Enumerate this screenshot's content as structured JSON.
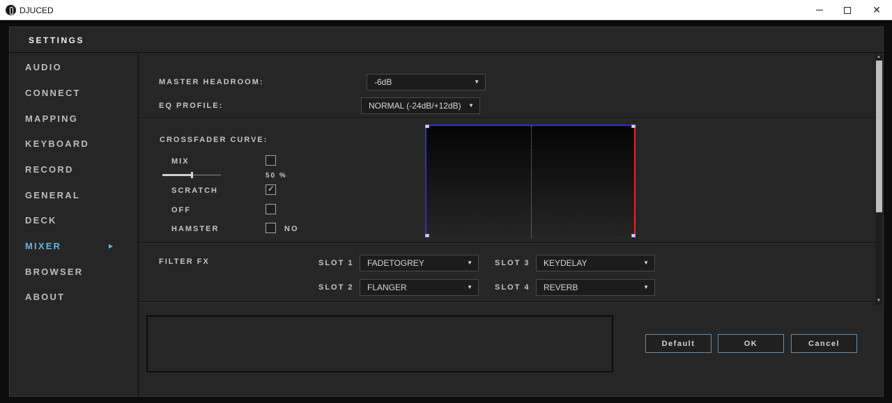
{
  "window": {
    "title": "DJUCED"
  },
  "settings": {
    "title": "SETTINGS"
  },
  "sidebar": {
    "items": [
      {
        "label": "AUDIO"
      },
      {
        "label": "CONNECT"
      },
      {
        "label": "MAPPING"
      },
      {
        "label": "KEYBOARD"
      },
      {
        "label": "RECORD"
      },
      {
        "label": "GENERAL"
      },
      {
        "label": "DECK"
      },
      {
        "label": "MIXER",
        "active": true
      },
      {
        "label": "BROWSER"
      },
      {
        "label": "ABOUT"
      }
    ]
  },
  "mixer": {
    "master_headroom": {
      "label": "MASTER HEADROOM:",
      "value": "-6dB"
    },
    "eq_profile": {
      "label": "EQ PROFILE:",
      "value": "NORMAL (-24dB/+12dB)"
    },
    "crossfader": {
      "label": "CROSSFADER CURVE:",
      "mix": {
        "label": "MIX",
        "checked": false
      },
      "slider": {
        "percent": 50,
        "value_text": "50",
        "unit": "%"
      },
      "scratch": {
        "label": "SCRATCH",
        "checked": true
      },
      "off": {
        "label": "OFF",
        "checked": false
      },
      "hamster": {
        "label": "HAMSTER",
        "checked": false,
        "state_text": "NO"
      }
    },
    "filter_fx": {
      "label": "FILTER FX",
      "slots": [
        {
          "label": "SLOT 1",
          "value": "FADETOGREY"
        },
        {
          "label": "SLOT 2",
          "value": "FLANGER"
        },
        {
          "label": "SLOT 3",
          "value": "KEYDELAY"
        },
        {
          "label": "SLOT 4",
          "value": "REVERB"
        }
      ]
    }
  },
  "buttons": {
    "default": "Default",
    "ok": "OK",
    "cancel": "Cancel"
  },
  "colors": {
    "accent": "#6bb3e0",
    "curve_left": "#2f2fd0",
    "curve_right": "#e82424",
    "button_border": "#5f8fb2"
  }
}
